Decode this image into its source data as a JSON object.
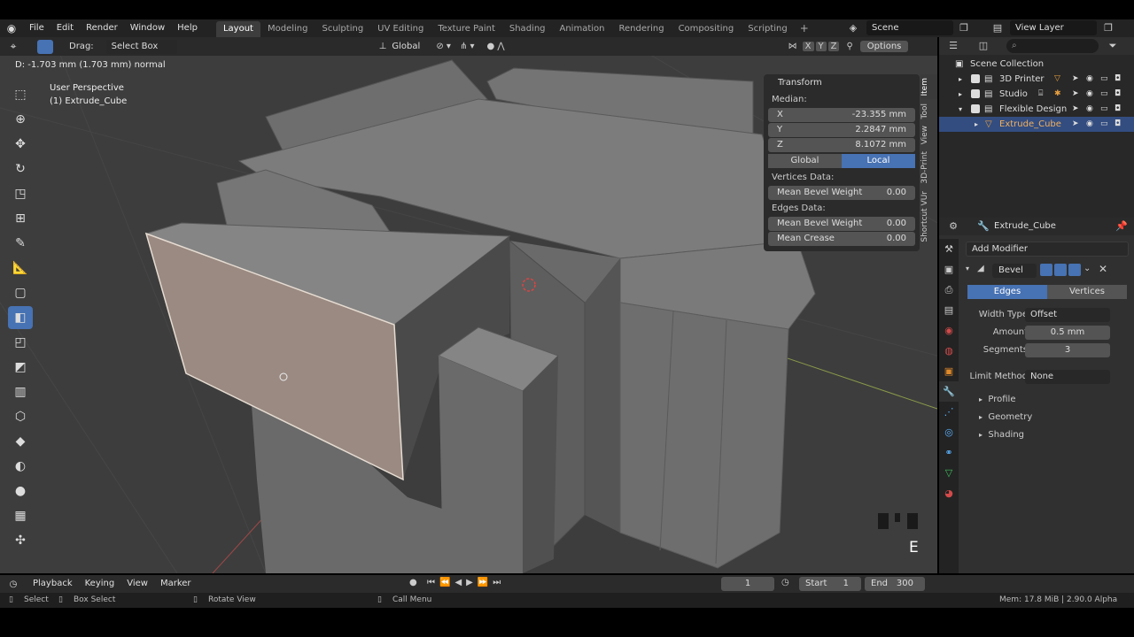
{
  "menus": [
    "File",
    "Edit",
    "Render",
    "Window",
    "Help"
  ],
  "workspaces": [
    "Layout",
    "Modeling",
    "Sculpting",
    "UV Editing",
    "Texture Paint",
    "Shading",
    "Animation",
    "Rendering",
    "Compositing",
    "Scripting"
  ],
  "active_workspace": "Layout",
  "scene": "Scene",
  "view_layer": "View Layer",
  "viewport": {
    "drag_label": "Drag:",
    "drag_value": "Select Box",
    "orientation": "Global",
    "options": "Options",
    "axes": [
      "X",
      "Y",
      "Z"
    ],
    "status": "D: -1.703 mm (1.703 mm) normal",
    "view_name": "User Perspective",
    "object_name": "(1) Extrude_Cube",
    "key_hint": "E"
  },
  "npanel": {
    "title": "Transform",
    "median": "Median:",
    "x_label": "X",
    "x": "-23.355 mm",
    "y_label": "Y",
    "y": "2.2847 mm",
    "z_label": "Z",
    "z": "8.1072 mm",
    "global": "Global",
    "local": "Local",
    "vertices_data": "Vertices Data:",
    "mean_bevel_weight": "Mean Bevel Weight",
    "vbw": "0.00",
    "edges_data": "Edges Data:",
    "ebw": "0.00",
    "mean_crease": "Mean Crease",
    "crease": "0.00",
    "tabs": [
      "Item",
      "Tool",
      "View",
      "3D-Print",
      "Shortcut VUr"
    ]
  },
  "outliner": {
    "root": "Scene Collection",
    "items": [
      "3D Printer",
      "Studio",
      "Flexible Design",
      "Extrude_Cube"
    ]
  },
  "properties": {
    "object": "Extrude_Cube",
    "add_modifier": "Add Modifier",
    "modifier_name": "Bevel",
    "edges": "Edges",
    "vertices": "Vertices",
    "width_type_label": "Width Type",
    "width_type": "Offset",
    "amount_label": "Amount",
    "amount": "0.5 mm",
    "segments_label": "Segments",
    "segments": "3",
    "limit_label": "Limit Method",
    "limit": "None",
    "sections": [
      "Profile",
      "Geometry",
      "Shading"
    ]
  },
  "timeline": {
    "menus": [
      "Playback",
      "Keying",
      "View",
      "Marker"
    ],
    "frame": "1",
    "start_label": "Start",
    "start": "1",
    "end_label": "End",
    "end": "300"
  },
  "statusbar": {
    "select": "Select",
    "box_select": "Box Select",
    "rotate": "Rotate View",
    "call_menu": "Call Menu",
    "memory": "Mem: 17.8 MiB | 2.90.0 Alpha"
  }
}
